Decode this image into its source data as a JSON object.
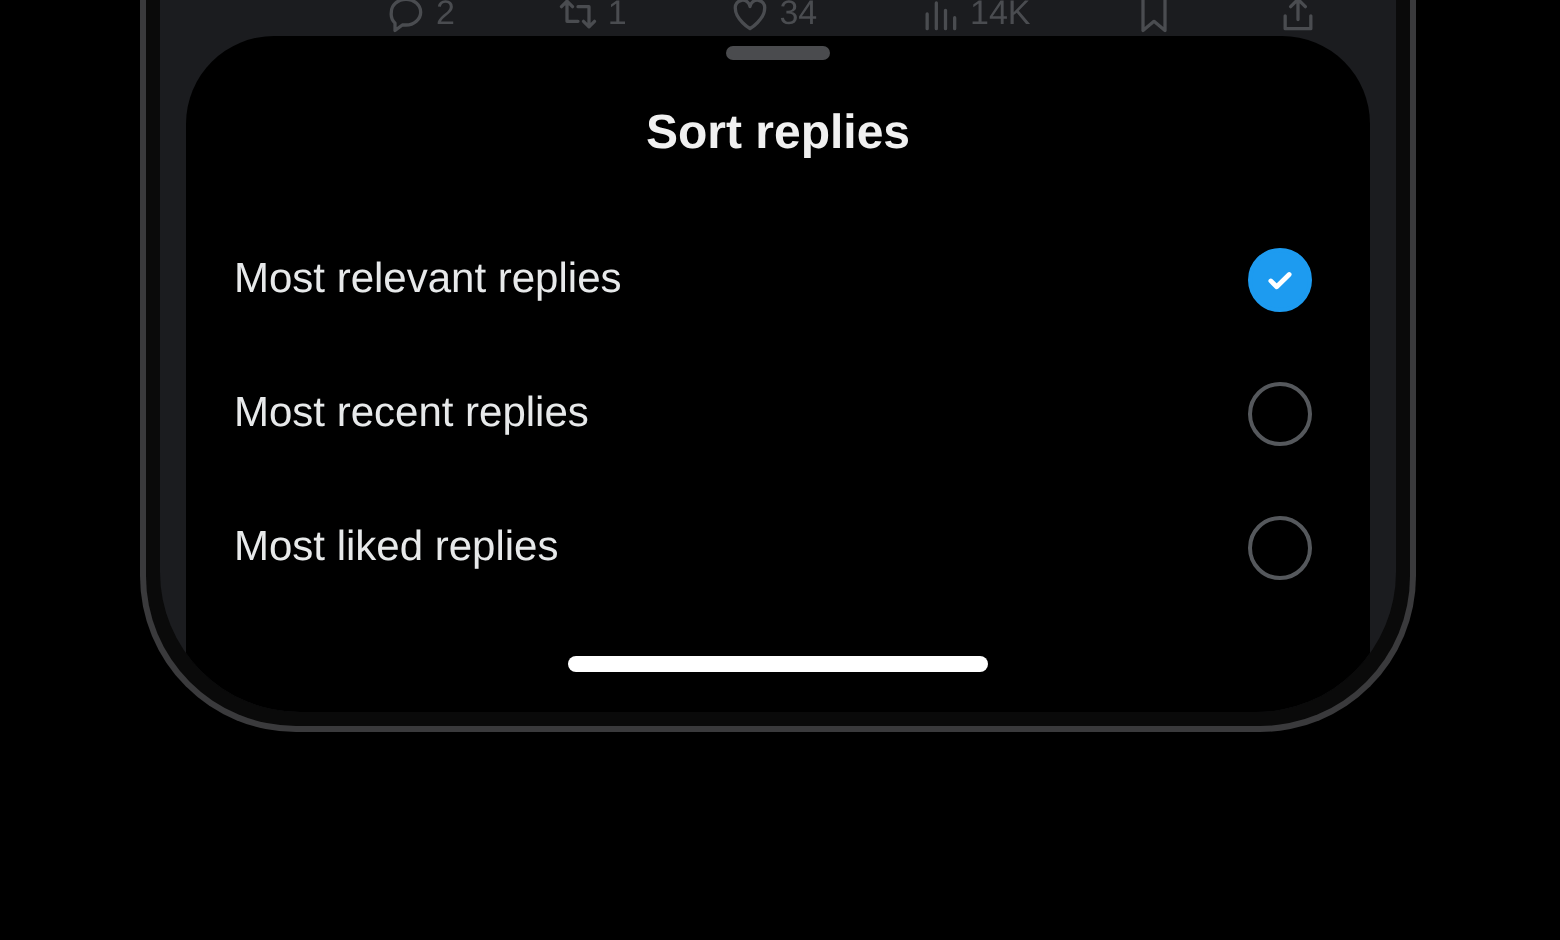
{
  "action_bar": [
    {
      "kind": "reply",
      "count": "2"
    },
    {
      "kind": "repost",
      "count": "1"
    },
    {
      "kind": "like",
      "count": "34"
    },
    {
      "kind": "views",
      "count": "14K"
    },
    {
      "kind": "bookmark"
    },
    {
      "kind": "share"
    }
  ],
  "sheet": {
    "title": "Sort replies",
    "options": [
      {
        "label": "Most relevant replies",
        "selected": true
      },
      {
        "label": "Most recent replies",
        "selected": false
      },
      {
        "label": "Most liked replies",
        "selected": false
      }
    ]
  }
}
